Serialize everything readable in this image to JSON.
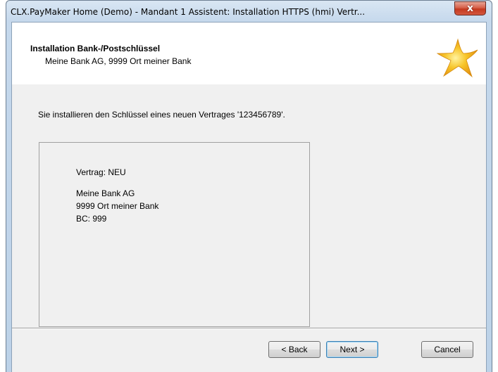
{
  "window": {
    "title": "CLX.PayMaker Home (Demo) - Mandant 1 Assistent: Installation HTTPS (hmi) Vertr...",
    "close_glyph": "x"
  },
  "header": {
    "title": "Installation Bank-/Postschlüssel",
    "subtitle": "Meine Bank AG, 9999 Ort meiner Bank",
    "logo_icon": "star-icon"
  },
  "main": {
    "intro": "Sie installieren den Schlüssel eines neuen Vertrages '123456789'.",
    "info": {
      "contract": "Vertrag: NEU",
      "bank_name": "Meine Bank AG",
      "bank_city": "9999 Ort meiner Bank",
      "bc": "BC: 999"
    }
  },
  "footer": {
    "back_label": "< Back",
    "next_label": "Next >",
    "cancel_label": "Cancel"
  },
  "colors": {
    "star": "#f5b616",
    "close_button": "#c7432a",
    "titlebar": "#c5d8ec"
  }
}
